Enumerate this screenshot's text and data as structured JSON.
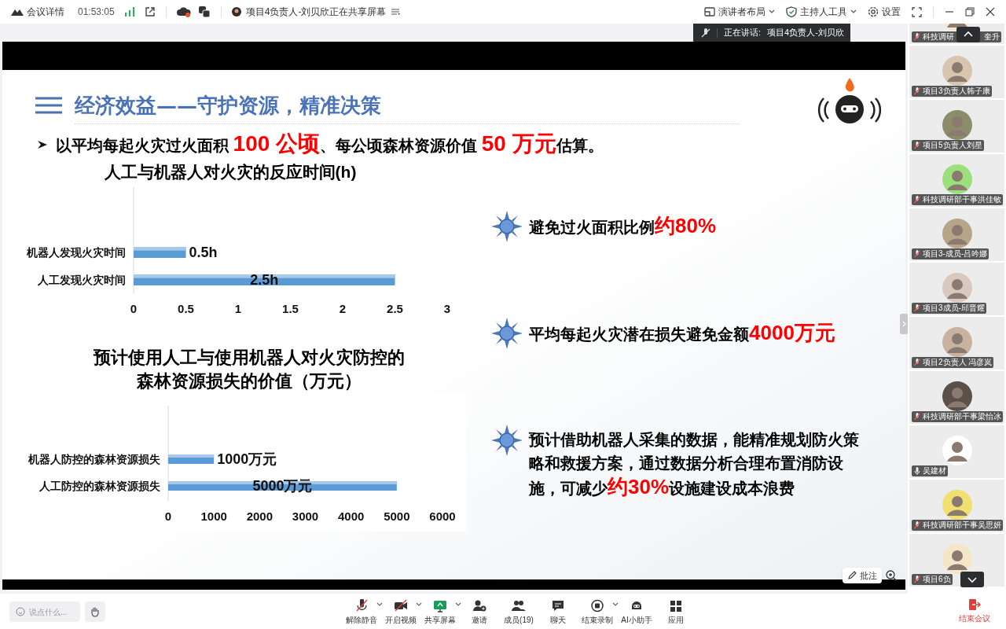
{
  "top_bar": {
    "meeting_details": "会议详情",
    "timer": "01:53:05",
    "sharing_notice": "项目4负责人-刘贝欣正在共享屏幕",
    "right_items": [
      {
        "label": "演讲者布局",
        "caret": true
      },
      {
        "label": "主持人工具",
        "caret": true
      },
      {
        "label": "设置",
        "caret": false
      }
    ]
  },
  "speaking_banner": {
    "label": "正在讲话:",
    "speaker": "项目4负责人-刘贝欣"
  },
  "slide": {
    "title": "经济效益——守护资源，精准决策",
    "headline": "以平均每起火灾过火面积 **100 公顷**、每公顷森林资源价值 **50 万元**估算。",
    "charts": [
      {
        "chart_data": {
          "type": "bar",
          "orientation": "horizontal",
          "title": "人工与机器人对火灾的反应时间(h)",
          "categories": [
            "机器人发现火灾时间",
            "人工发现火灾时间"
          ],
          "values": [
            0.5,
            2.5
          ],
          "xlim": [
            0,
            3
          ],
          "xticks": [
            0,
            0.5,
            1,
            1.5,
            2,
            2.5,
            3
          ],
          "value_labels": [
            "0.5h",
            "2.5h"
          ]
        }
      },
      {
        "chart_data": {
          "type": "bar",
          "orientation": "horizontal",
          "title": "预计使用人工与使用机器人对火灾防控的森林资源损失的价值（万元）",
          "categories": [
            "机器人防控的森林资源损失",
            "人工防控的森林资源损失"
          ],
          "values": [
            1000,
            5000
          ],
          "xlim": [
            0,
            6000
          ],
          "xticks": [
            0,
            1000,
            2000,
            3000,
            4000,
            5000,
            6000
          ],
          "value_labels": [
            "1000万元",
            "5000万元"
          ]
        }
      }
    ],
    "points": [
      "避免过火面积比例**约80%**",
      "平均每起火灾潜在损失避免金额**4000万元**",
      "预计借助机器人采集的数据，能精准规划防火策略和救援方案，通过数据分析合理布置消防设施，可减少**约30%**设施建设成本浪费"
    ]
  },
  "annotate_button": "批注",
  "participants": [
    {
      "name_parts": [
        "科技调研",
        "奎升"
      ],
      "muted": true
    },
    {
      "name_parts": [
        "项目3负责人韩子康"
      ],
      "muted": true
    },
    {
      "name_parts": [
        "项目5负责人刘星"
      ],
      "muted": true
    },
    {
      "name_parts": [
        "科技调研部干事洪佳敏"
      ],
      "muted": true
    },
    {
      "name_parts": [
        "项目3-成员-吕吟娜"
      ],
      "muted": true
    },
    {
      "name_parts": [
        "项目3成员-邱晋耀"
      ],
      "muted": true
    },
    {
      "name_parts": [
        "项目2负责人 冯彦岚"
      ],
      "muted": true
    },
    {
      "name_parts": [
        "科技调研部干事梁怡冰"
      ],
      "muted": true
    },
    {
      "name_parts": [
        "吴建材"
      ],
      "muted": false
    },
    {
      "name_parts": [
        "科技调研部干事吴思妍"
      ],
      "muted": true
    },
    {
      "name_parts": [
        "项目6负"
      ],
      "muted": true
    }
  ],
  "bottom_bar": {
    "chat_input": {
      "placeholder": "说点什么..."
    },
    "tools": [
      {
        "label": "解除静音",
        "caret": true
      },
      {
        "label": "开启视频",
        "caret": true
      },
      {
        "label": "共享屏幕",
        "caret": true
      },
      {
        "label": "邀请",
        "caret": false
      },
      {
        "label": "成员(19)",
        "caret": false
      },
      {
        "label": "聊天",
        "caret": false
      },
      {
        "label": "结束录制",
        "caret": true
      },
      {
        "label": "AI小助手",
        "caret": false
      },
      {
        "label": "应用",
        "caret": false
      }
    ],
    "end_meeting": "结束会议"
  }
}
